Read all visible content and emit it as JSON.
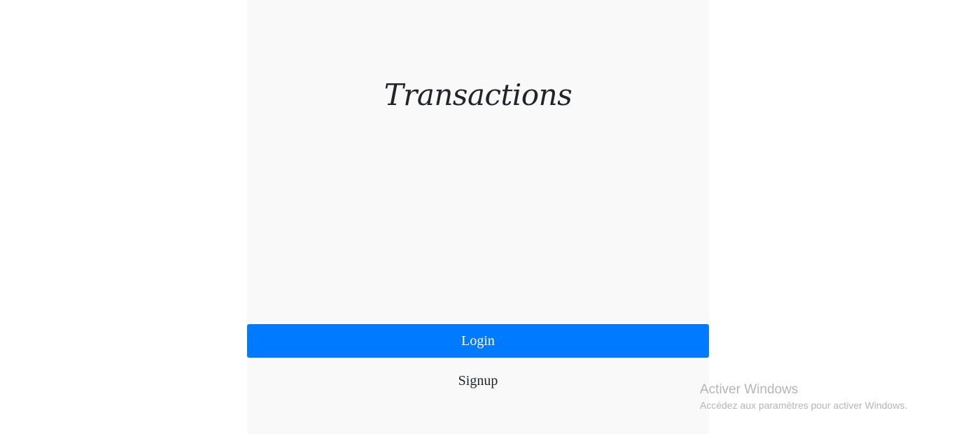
{
  "app": {
    "title": "Transactions"
  },
  "actions": {
    "login_label": "Login",
    "signup_label": "Signup"
  },
  "watermark": {
    "title": "Activer Windows",
    "subtitle": "Accédez aux paramètres pour activer Windows."
  },
  "colors": {
    "accent": "#007bff",
    "panel_background": "#f9f9f9",
    "text": "#212529",
    "watermark": "#b5b5b5"
  }
}
